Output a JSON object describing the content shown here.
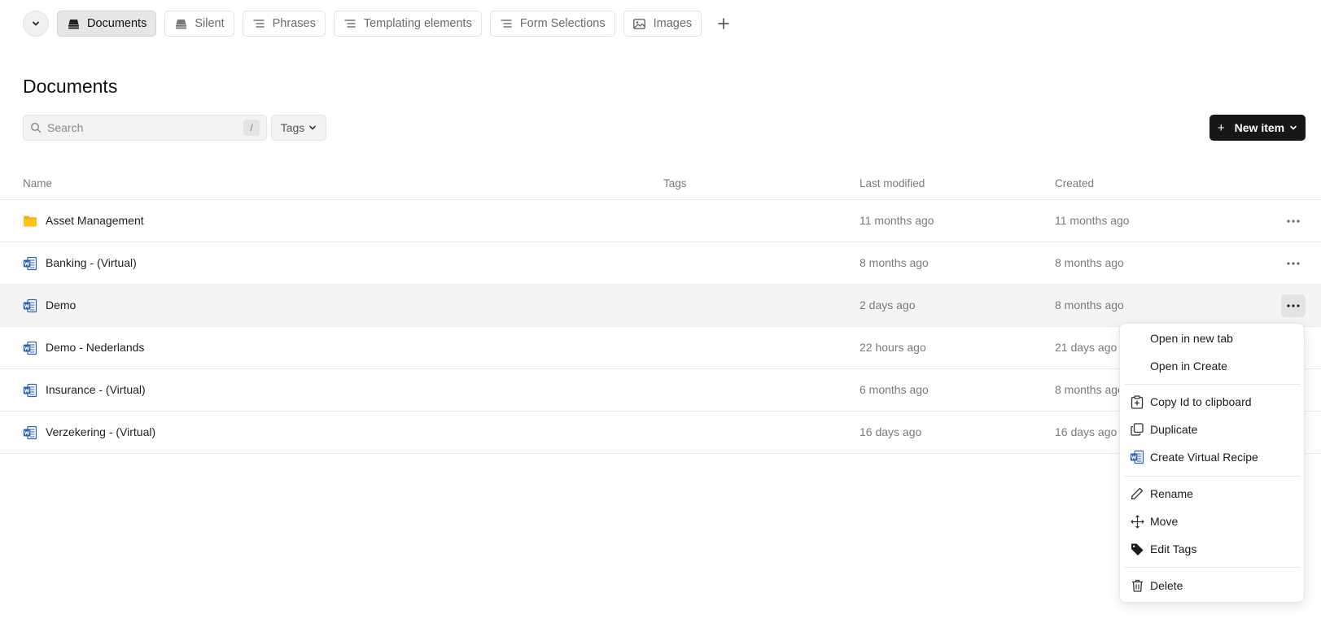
{
  "tabs": [
    {
      "label": "Documents",
      "icon": "stack-icon",
      "active": true
    },
    {
      "label": "Silent",
      "icon": "stack-icon",
      "active": false
    },
    {
      "label": "Phrases",
      "icon": "list-icon",
      "active": false
    },
    {
      "label": "Templating elements",
      "icon": "list-icon",
      "active": false
    },
    {
      "label": "Form Selections",
      "icon": "list-icon",
      "active": false
    },
    {
      "label": "Images",
      "icon": "image-icon",
      "active": false
    }
  ],
  "page": {
    "title": "Documents"
  },
  "toolbar": {
    "search_placeholder": "Search",
    "search_shortcut": "/",
    "tags_label": "Tags",
    "new_item_label": "New item"
  },
  "table": {
    "columns": {
      "name": "Name",
      "tags": "Tags",
      "modified": "Last modified",
      "created": "Created"
    },
    "rows": [
      {
        "name": "Asset Management",
        "type": "folder",
        "modified": "11 months ago",
        "created": "11 months ago"
      },
      {
        "name": "Banking - (Virtual)",
        "type": "word",
        "modified": "8 months ago",
        "created": "8 months ago"
      },
      {
        "name": "Demo",
        "type": "word",
        "modified": "2 days ago",
        "created": "8 months ago"
      },
      {
        "name": "Demo - Nederlands",
        "type": "word",
        "modified": "22 hours ago",
        "created": "21 days ago"
      },
      {
        "name": "Insurance - (Virtual)",
        "type": "word",
        "modified": "6 months ago",
        "created": "8 months ago"
      },
      {
        "name": "Verzekering - (Virtual)",
        "type": "word",
        "modified": "16 days ago",
        "created": "16 days ago"
      }
    ]
  },
  "context_menu": {
    "items": [
      {
        "label": "Open in new tab"
      },
      {
        "label": "Open in Create"
      },
      {
        "label": "Copy Id to clipboard",
        "icon": "clipboard-icon"
      },
      {
        "label": "Duplicate",
        "icon": "duplicate-icon"
      },
      {
        "label": "Create Virtual Recipe",
        "icon": "word-document-icon"
      },
      {
        "label": "Rename",
        "icon": "pencil-icon"
      },
      {
        "label": "Move",
        "icon": "move-icon"
      },
      {
        "label": "Edit Tags",
        "icon": "tag-icon"
      },
      {
        "label": "Delete",
        "icon": "trash-icon"
      }
    ]
  },
  "colors": {
    "folder": "#f5b400",
    "word": "#2b5fb4",
    "primary_button": "#171717"
  }
}
